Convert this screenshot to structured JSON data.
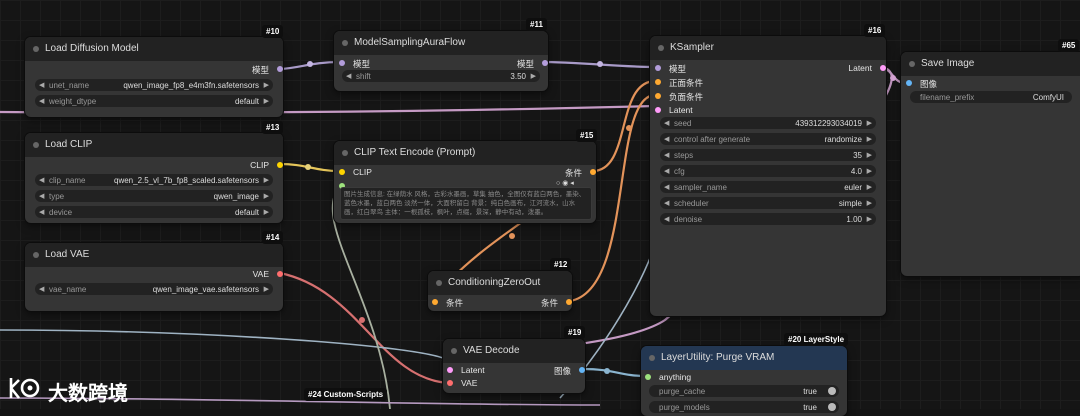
{
  "nodes": {
    "n10": {
      "id": "#10",
      "title": "Load Diffusion Model",
      "output": "模型",
      "widgets": {
        "unet_name": {
          "k": "unet_name",
          "v": "qwen_image_fp8_e4m3fn.safetensors"
        },
        "weight_dtype": {
          "k": "weight_dtype",
          "v": "default"
        }
      }
    },
    "n11": {
      "id": "#11",
      "title": "ModelSamplingAuraFlow",
      "input": "模型",
      "output": "模型",
      "widgets": {
        "shift": {
          "k": "shift",
          "v": "3.50"
        }
      }
    },
    "n16": {
      "id": "#16",
      "title": "KSampler",
      "inputs": [
        "模型",
        "正面条件",
        "负面条件",
        "Latent"
      ],
      "output": "Latent",
      "widgets": {
        "seed": {
          "k": "seed",
          "v": "439312293034019"
        },
        "control": {
          "k": "control after generate",
          "v": "randomize"
        },
        "steps": {
          "k": "steps",
          "v": "35"
        },
        "cfg": {
          "k": "cfg",
          "v": "4.0"
        },
        "sampler": {
          "k": "sampler_name",
          "v": "euler"
        },
        "scheduler": {
          "k": "scheduler",
          "v": "simple"
        },
        "denoise": {
          "k": "denoise",
          "v": "1.00"
        }
      }
    },
    "n65": {
      "id": "#65",
      "title": "Save Image",
      "input": "图像",
      "widgets": {
        "filename_prefix": {
          "k": "filename_prefix",
          "v": "ComfyUI"
        }
      }
    },
    "n13": {
      "id": "#13",
      "title": "Load CLIP",
      "output": "CLIP",
      "widgets": {
        "clip_name": {
          "k": "clip_name",
          "v": "qwen_2.5_vl_7b_fp8_scaled.safetensors"
        },
        "type": {
          "k": "type",
          "v": "qwen_image"
        },
        "device": {
          "k": "device",
          "v": "default"
        }
      }
    },
    "n15": {
      "id": "#15",
      "title": "CLIP Text Encode (Prompt)",
      "input": "CLIP",
      "output": "条件",
      "text": "图片生成信息: 在绿荫水 风格，古彩水墨画，草集 抽色，全图仅有蓝白两色，墨染、蓝色水墨，蓝白两色 淡然一体，大面积留白 背景：纯白色画布，江河流水，山水画，红白翠鸟 主体：一根孤枝，枫叶，点缀，景深，静中有动，泼墨。"
    },
    "n14": {
      "id": "#14",
      "title": "Load VAE",
      "output": "VAE",
      "widgets": {
        "vae_name": {
          "k": "vae_name",
          "v": "qwen_image_vae.safetensors"
        }
      }
    },
    "n12": {
      "id": "#12",
      "title": "ConditioningZeroOut",
      "input": "条件",
      "output": "条件"
    },
    "n19": {
      "id": "#19",
      "title": "VAE Decode",
      "inputs": [
        "Latent",
        "VAE"
      ],
      "output": "图像"
    },
    "n20": {
      "id": "#20 LayerStyle",
      "title": "LayerUtility: Purge VRAM",
      "input": "anything",
      "widgets": {
        "purge_cache": {
          "k": "purge_cache",
          "v": "true"
        },
        "purge_models": {
          "k": "purge_models",
          "v": "true"
        }
      }
    },
    "n24": {
      "id": "#24 Custom-Scripts"
    }
  },
  "watermark": {
    "text": "大数跨境"
  },
  "colors": {
    "model": "#b39ddb",
    "clip": "#ffd500",
    "conditioning": "#ffa931",
    "latent": "#ff9cf9",
    "vae": "#ff6e6e",
    "image": "#64b5f6",
    "any": "#9ee27d",
    "text": "#a8b0a0"
  }
}
